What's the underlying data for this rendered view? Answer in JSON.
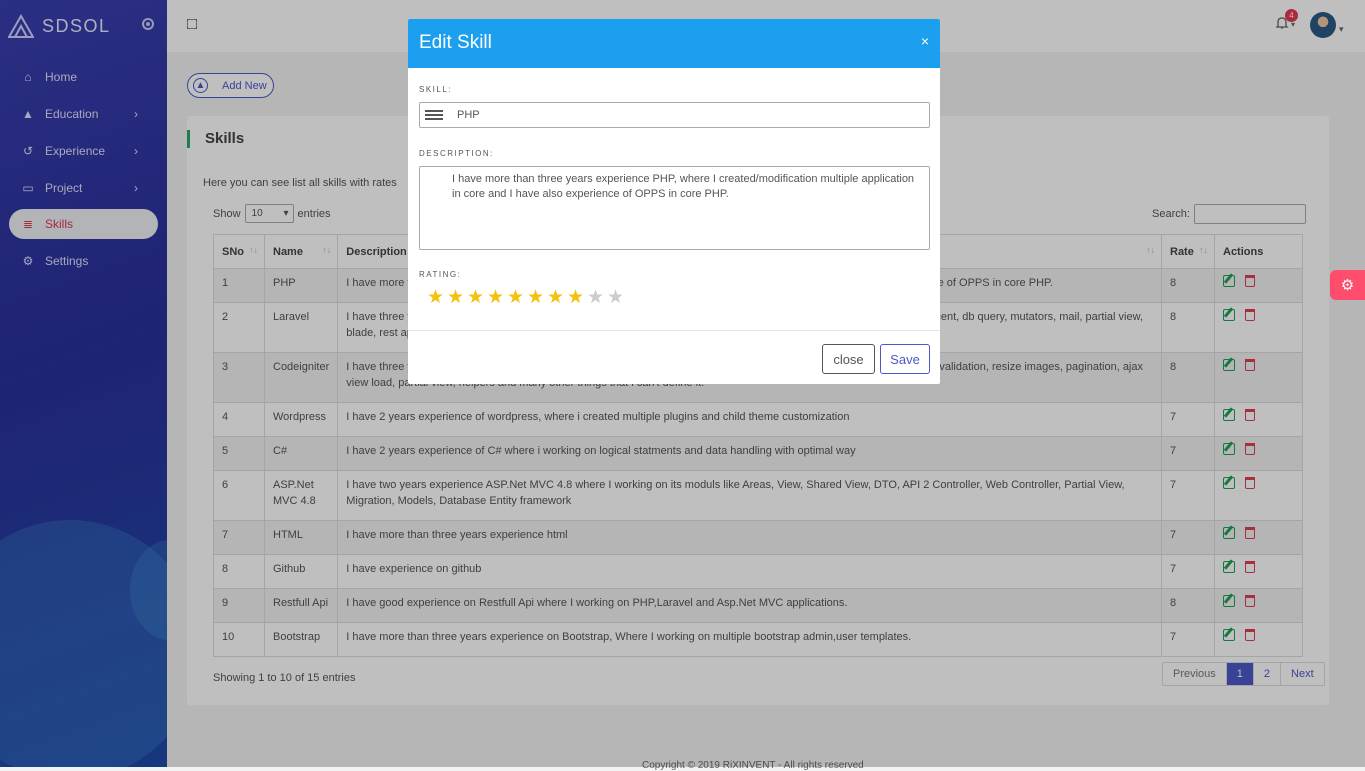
{
  "brand": {
    "name": "SDSOL"
  },
  "sidebar": {
    "items": [
      {
        "label": "Home",
        "icon": "home-icon"
      },
      {
        "label": "Education",
        "icon": "graduation-cap-icon"
      },
      {
        "label": "Experience",
        "icon": "history-icon"
      },
      {
        "label": "Project",
        "icon": "folder-icon"
      },
      {
        "label": "Skills",
        "icon": "list-icon"
      },
      {
        "label": "Settings",
        "icon": "gear-icon"
      }
    ]
  },
  "topbar": {
    "notification_count": "4"
  },
  "content": {
    "add_new_label": "Add New",
    "title": "Skills",
    "subtitle": "Here you can see list all skills with rates",
    "show_label": "Show",
    "entries_label": "entries",
    "page_length": "10",
    "search_label": "Search:",
    "columns": [
      "SNo",
      "Name",
      "Description",
      "Rate",
      "Actions"
    ],
    "rows": [
      {
        "sno": "1",
        "name": "PHP",
        "desc_left": "I have more t",
        "desc_right": "nce of OPPS in core PHP.",
        "rate": "8"
      },
      {
        "sno": "2",
        "name": "Laravel",
        "desc_left": "I have three y",
        "desc_right": "uent, db query, mutators, mail, partial view,",
        "desc_left2": "blade, rest ap",
        "rate": "8"
      },
      {
        "sno": "3",
        "name": "Codeigniter",
        "desc_left": "I have three y",
        "desc_right": "validation, resize images, pagination, ajax",
        "desc_left2": "view load, partial view, helpers and many other things that i can't define it.",
        "rate": "8"
      },
      {
        "sno": "4",
        "name": "Wordpress",
        "desc": "I have 2 years experience of wordpress, where i created multiple plugins and child theme customization",
        "rate": "7"
      },
      {
        "sno": "5",
        "name": "C#",
        "desc": "I have 2 years experience of C# where i working on logical statments and data handling with optimal way",
        "rate": "7"
      },
      {
        "sno": "6",
        "name": "ASP.Net MVC 4.8",
        "desc": "I have two years experience ASP.Net MVC 4.8 where I working on its moduls like Areas, View, Shared View, DTO, API 2 Controller, Web Controller, Partial View, Migration, Models, Database Entity framework",
        "rate": "7"
      },
      {
        "sno": "7",
        "name": "HTML",
        "desc": "I have more than three years experience html",
        "rate": "7"
      },
      {
        "sno": "8",
        "name": "Github",
        "desc": "I have experience on github",
        "rate": "7"
      },
      {
        "sno": "9",
        "name": "Restfull Api",
        "desc": "I have good experience on Restfull Api where I working on PHP,Laravel and Asp.Net MVC applications.",
        "rate": "8"
      },
      {
        "sno": "10",
        "name": "Bootstrap",
        "desc": "I have more than three years experience on Bootstrap, Where I working on multiple bootstrap admin,user templates.",
        "rate": "7"
      }
    ],
    "info": "Showing 1 to 10 of 15 entries",
    "pager": {
      "prev": "Previous",
      "pages": [
        "1",
        "2"
      ],
      "next": "Next"
    },
    "copyright": "Copyright © 2019 RiXINVENT - All rights reserved"
  },
  "modal": {
    "title": "Edit Skill",
    "close_icon": "×",
    "skill_label": "SKILL:",
    "skill_value": "PHP",
    "description_label": "DESCRIPTION:",
    "description_value": "I have more than three years experience PHP, where I created/modification multiple application in core and I have also experience of OPPS in core PHP.",
    "rating_label": "RATING:",
    "rating": 8,
    "rating_max": 10,
    "close_label": "close",
    "save_label": "Save"
  },
  "colors": {
    "accent": "#4b59c8",
    "modal_header": "#1d9ff0",
    "star": "#f3c20f",
    "edit": "#20a05a",
    "delete": "#e04050",
    "settings_tab": "#ff4d6d"
  }
}
